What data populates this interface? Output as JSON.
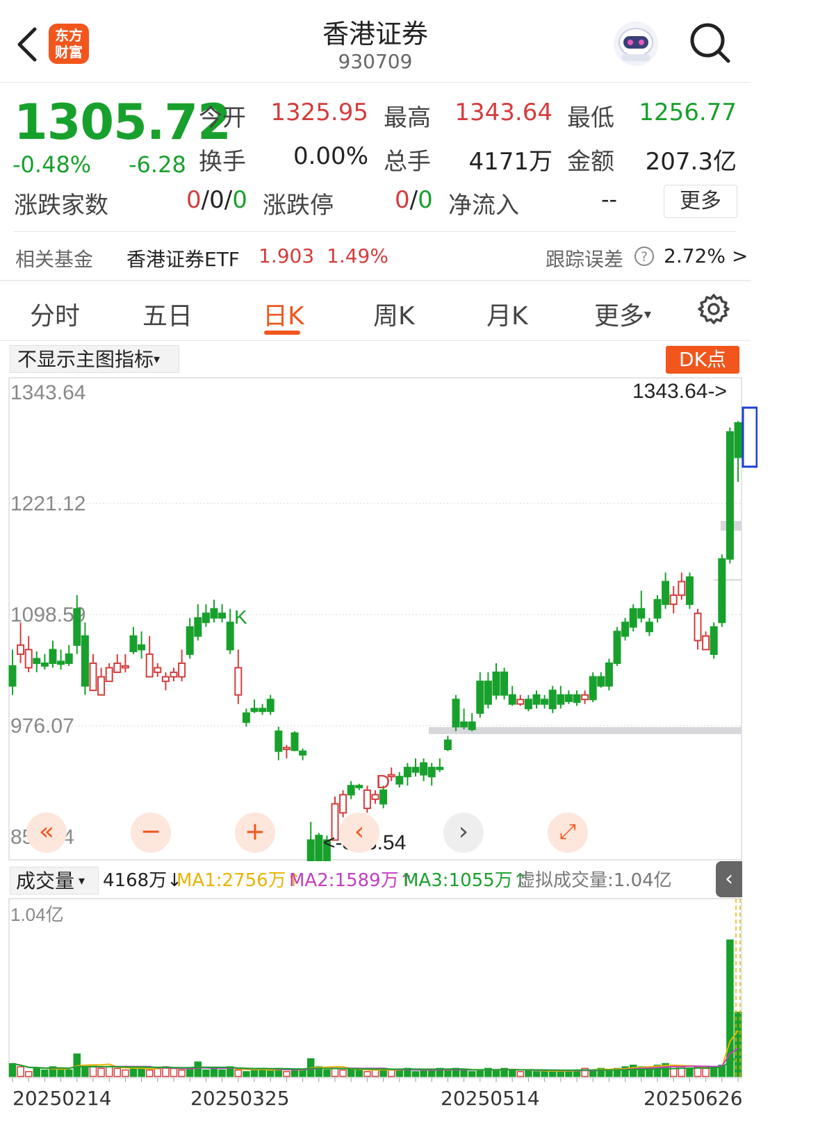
{
  "header": {
    "title": "香港证券",
    "code": "930709",
    "logo_line1": "东方",
    "logo_line2": "财富"
  },
  "quote": {
    "price": "1305.72",
    "pct": "-0.48%",
    "change": "-6.28",
    "open_label": "今开",
    "open": "1325.95",
    "high_label": "最高",
    "high": "1343.64",
    "low_label": "最低",
    "low": "1256.77",
    "turnover_label": "换手",
    "turnover": "0.00%",
    "volume_label": "总手",
    "volume": "4171万",
    "amount_label": "金额",
    "amount": "207.3亿",
    "breadth_label": "涨跌家数",
    "breadth_up": "0",
    "breadth_flat": "0",
    "breadth_down": "0",
    "limit_label": "涨跌停",
    "limit_up": "0",
    "limit_down": "0",
    "inflow_label": "净流入",
    "inflow": "--",
    "more_label": "更多"
  },
  "fund": {
    "label": "相关基金",
    "name": "香港证券ETF",
    "price": "1.903",
    "pct": "1.49%",
    "tracking_label": "跟踪误差",
    "tracking": "2.72% >"
  },
  "tabs": {
    "t1": "分时",
    "t2": "五日",
    "t3": "日K",
    "t4": "周K",
    "t5": "月K",
    "t6": "更多",
    "t6_arrow": "▾"
  },
  "indicator": {
    "main_select": "不显示主图指标",
    "dk_label": "DK点"
  },
  "chart": {
    "y_labels": [
      "1343.64",
      "1221.12",
      "1098.59",
      "976.07",
      "853.54"
    ],
    "max_marker": "1343.64->",
    "min_marker": "<-853.54",
    "signal_k": "K",
    "signal_d": "D",
    "candles_start": 1050,
    "candles": [
      [
        -8,
        -30,
        10,
        -40
      ],
      [
        5,
        15,
        40,
        -5
      ],
      [
        -10,
        10,
        25,
        -15
      ],
      [
        0,
        -5,
        8,
        -15
      ],
      [
        -5,
        -8,
        5,
        -12
      ],
      [
        10,
        -5,
        20,
        -10
      ],
      [
        -3,
        -6,
        10,
        -12
      ],
      [
        5,
        -5,
        15,
        -8
      ],
      [
        55,
        15,
        70,
        5
      ],
      [
        25,
        -30,
        40,
        -40
      ],
      [
        -35,
        -5,
        5,
        -10
      ],
      [
        -40,
        -20,
        -10,
        -25
      ],
      [
        -25,
        -10,
        -5,
        -20
      ],
      [
        -15,
        -5,
        5,
        -12
      ],
      [
        -10,
        -8,
        5,
        -15
      ],
      [
        25,
        8,
        35,
        5
      ],
      [
        15,
        10,
        30,
        0
      ],
      [
        -20,
        5,
        25,
        -10
      ],
      [
        -15,
        -10,
        -5,
        -20
      ],
      [
        -25,
        -20,
        -15,
        -35
      ],
      [
        -20,
        -15,
        -10,
        -25
      ],
      [
        -20,
        -5,
        10,
        -25
      ],
      [
        35,
        5,
        45,
        0
      ],
      [
        45,
        25,
        60,
        20
      ],
      [
        50,
        40,
        60,
        35
      ],
      [
        55,
        45,
        65,
        40
      ],
      [
        50,
        45,
        60,
        40
      ],
      [
        40,
        10,
        55,
        5
      ],
      [
        -40,
        -10,
        10,
        -50
      ],
      [
        -60,
        -70,
        -55,
        -75
      ],
      [
        -55,
        -58,
        -45,
        -60
      ],
      [
        -55,
        -58,
        -50,
        -62
      ],
      [
        -45,
        -58,
        -40,
        -62
      ],
      [
        -80,
        -102,
        -75,
        -112
      ],
      [
        -100,
        -98,
        -95,
        -110
      ],
      [
        -82,
        -101,
        -80,
        -102
      ],
      [
        -102,
        -106,
        -99,
        -112
      ],
      [
        -200,
        -240,
        -180,
        -245
      ],
      [
        -195,
        -242,
        -192,
        -245
      ],
      [
        -200,
        -250,
        -195,
        -255
      ],
      [
        -200,
        -160,
        -152,
        -200
      ],
      [
        -170,
        -150,
        -145,
        -175
      ],
      [
        -140,
        -150,
        -135,
        -155
      ],
      [
        -140,
        -142,
        -138,
        -145
      ],
      [
        -165,
        -145,
        -140,
        -170
      ],
      [
        -155,
        -150,
        -145,
        -160
      ],
      [
        -145,
        -160,
        -140,
        -165
      ],
      [
        -130,
        -128,
        -120,
        -135
      ],
      [
        -130,
        -138,
        -125,
        -142
      ],
      [
        -120,
        -130,
        -115,
        -140
      ],
      [
        -120,
        -125,
        -110,
        -130
      ],
      [
        -115,
        -128,
        -110,
        -135
      ],
      [
        -120,
        -130,
        -115,
        -140
      ],
      [
        -120,
        -122,
        -110,
        -125
      ],
      [
        -90,
        -100,
        -85,
        -102
      ],
      [
        -45,
        -75,
        -40,
        -80
      ],
      [
        -70,
        -75,
        -55,
        -78
      ],
      [
        -70,
        -78,
        -60,
        -80
      ],
      [
        -25,
        -60,
        -15,
        -65
      ],
      [
        -25,
        -50,
        -15,
        -55
      ],
      [
        -15,
        -40,
        -5,
        -45
      ],
      [
        -15,
        -40,
        -10,
        -45
      ],
      [
        -40,
        -50,
        -30,
        -52
      ],
      [
        -50,
        -45,
        -40,
        -52
      ],
      [
        -45,
        -55,
        -40,
        -58
      ],
      [
        -40,
        -50,
        -35,
        -55
      ],
      [
        -45,
        -50,
        -40,
        -55
      ],
      [
        -35,
        -55,
        -30,
        -60
      ],
      [
        -40,
        -50,
        -30,
        -55
      ],
      [
        -40,
        -47,
        -35,
        -50
      ],
      [
        -40,
        -48,
        -35,
        -52
      ],
      [
        -45,
        -40,
        -35,
        -50
      ],
      [
        -20,
        -45,
        -15,
        -48
      ],
      [
        -20,
        -30,
        -15,
        -32
      ],
      [
        -5,
        -30,
        0,
        -35
      ],
      [
        30,
        -5,
        35,
        -8
      ],
      [
        40,
        25,
        45,
        20
      ],
      [
        55,
        35,
        60,
        30
      ],
      [
        55,
        45,
        75,
        40
      ],
      [
        40,
        30,
        45,
        25
      ],
      [
        65,
        45,
        70,
        40
      ],
      [
        85,
        60,
        95,
        55
      ],
      [
        60,
        70,
        80,
        50
      ],
      [
        70,
        85,
        95,
        65
      ],
      [
        90,
        60,
        95,
        55
      ],
      [
        20,
        50,
        55,
        10
      ],
      [
        10,
        25,
        30,
        15
      ],
      [
        35,
        5,
        40,
        0
      ],
      [
        110,
        40,
        115,
        35
      ],
      [
        250,
        110,
        255,
        105
      ],
      [
        260,
        222,
        262,
        195
      ]
    ],
    "volumes": [
      0.08,
      0.06,
      0.03,
      0.05,
      0.04,
      0.06,
      0.05,
      0.04,
      0.14,
      0.06,
      0.07,
      0.05,
      0.06,
      0.05,
      0.04,
      0.06,
      0.05,
      0.04,
      0.05,
      0.06,
      0.05,
      0.04,
      0.05,
      0.09,
      0.04,
      0.05,
      0.04,
      0.06,
      0.04,
      0.03,
      0.04,
      0.05,
      0.04,
      0.05,
      0.03,
      0.04,
      0.04,
      0.11,
      0.06,
      0.04,
      0.05,
      0.04,
      0.05,
      0.04,
      0.03,
      0.04,
      0.05,
      0.04,
      0.04,
      0.05,
      0.03,
      0.04,
      0.04,
      0.05,
      0.04,
      0.05,
      0.04,
      0.03,
      0.04,
      0.05,
      0.04,
      0.05,
      0.04,
      0.03,
      0.04,
      0.03,
      0.04,
      0.03,
      0.03,
      0.04,
      0.04,
      0.05,
      0.04,
      0.05,
      0.04,
      0.05,
      0.06,
      0.07,
      0.06,
      0.06,
      0.07,
      0.08,
      0.07,
      0.06,
      0.05,
      0.06,
      0.05,
      0.06,
      0.07,
      0.85,
      0.4
    ]
  },
  "volume": {
    "select": "成交量",
    "current": "4168万",
    "current_arrow": "↓",
    "ma1": "MA1:2756万",
    "ma1_arrow": "↑",
    "ma2": "MA2:1589万",
    "ma2_arrow": "↑",
    "ma3": "MA3:1055万",
    "ma3_arrow": "↑",
    "virtual": "虚拟成交量:1.04亿",
    "axis_max": "1.04亿",
    "colors": {
      "ma1": "#e8b400",
      "ma2": "#c23ec2",
      "ma3": "#18a02c"
    }
  },
  "dates": [
    "20250214",
    "20250325",
    "20250514",
    "20250626"
  ]
}
